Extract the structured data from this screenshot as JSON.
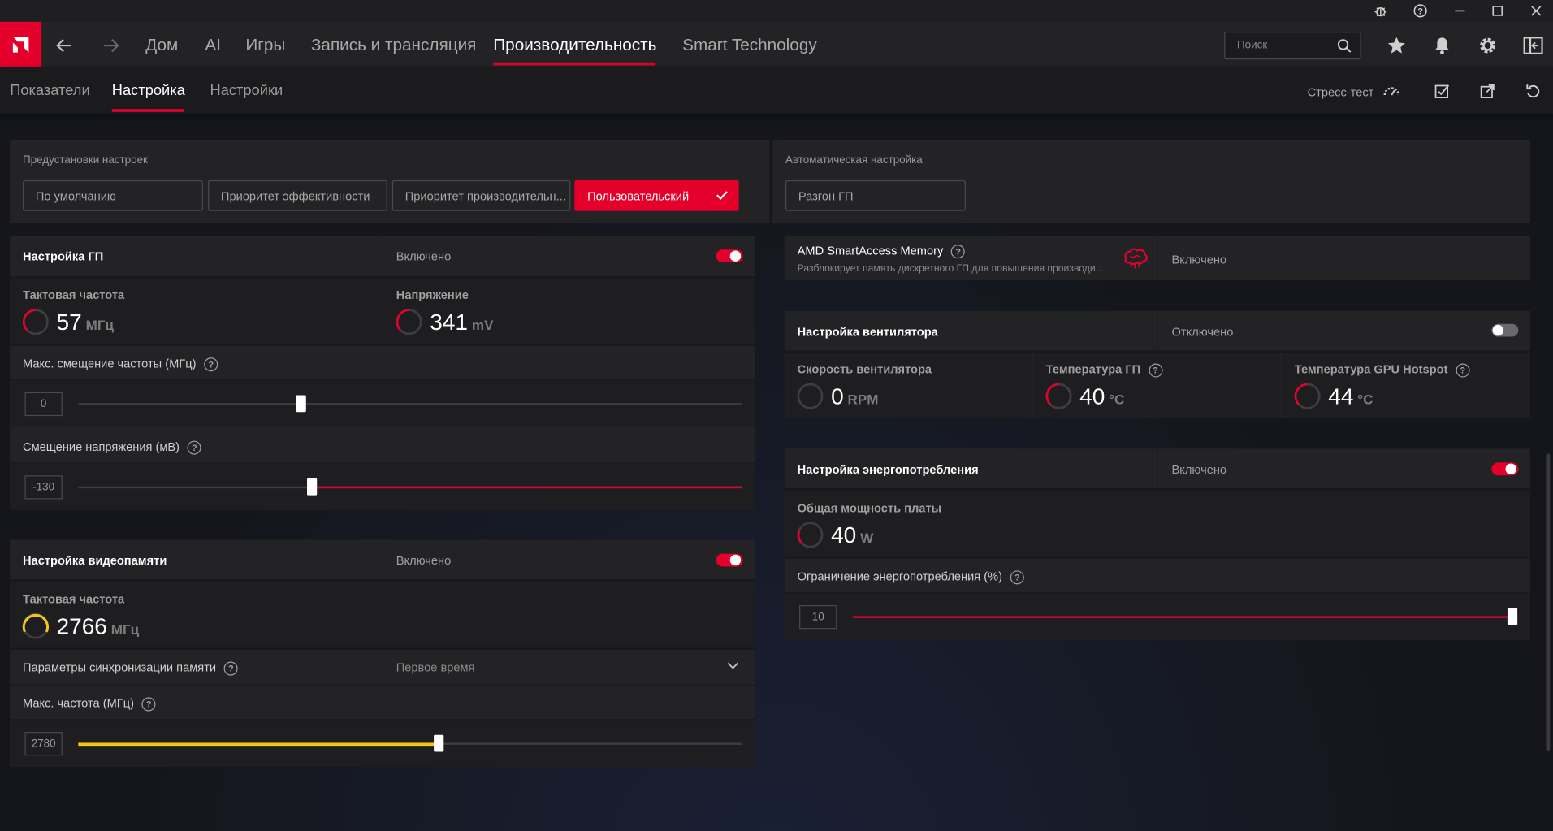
{
  "nav": {
    "items": [
      "Дом",
      "AI",
      "Игры",
      "Запись и трансляция",
      "Производительность",
      "Smart Technology"
    ],
    "active": "Производительность",
    "search_placeholder": "Поиск"
  },
  "subnav": {
    "tabs": [
      "Показатели",
      "Настройка",
      "Настройки"
    ],
    "active": "Настройка",
    "stress_test": "Стресс-тест"
  },
  "presets": {
    "label": "Предустановки настроек",
    "buttons": [
      "По умолчанию",
      "Приоритет эффективности",
      "Приоритет производительн...",
      "Пользовательский"
    ],
    "selected": "Пользовательский"
  },
  "auto_tune": {
    "label": "Автоматическая настройка",
    "button": "Разгон ГП"
  },
  "gpu_tuning": {
    "title": "Настройка ГП",
    "state": "Включено",
    "clock": {
      "label": "Тактовая частота",
      "value": "57",
      "unit": "МГц"
    },
    "voltage": {
      "label": "Напряжение",
      "value": "341",
      "unit": "mV"
    },
    "max_offset": {
      "label": "Макс. смещение частоты (МГц)",
      "value": "0",
      "percent": 33.5
    },
    "voltage_offset": {
      "label": "Смещение напряжения (мВ)",
      "value": "-130",
      "percent": 35
    }
  },
  "vram_tuning": {
    "title": "Настройка видеопамяти",
    "state": "Включено",
    "clock": {
      "label": "Тактовая частота",
      "value": "2766",
      "unit": "МГц"
    },
    "timing": {
      "label": "Параметры синхронизации памяти",
      "value": "Первое время"
    },
    "max_clock": {
      "label": "Макс. частота (МГц)",
      "value": "2780",
      "percent": 54
    }
  },
  "sam": {
    "title": "AMD SmartAccess Memory",
    "desc": "Разблокирует память дискретного ГП для повышения производи...",
    "state": "Включено"
  },
  "fan_tuning": {
    "title": "Настройка вентилятора",
    "state": "Отключено",
    "speed": {
      "label": "Скорость вентилятора",
      "value": "0",
      "unit": "RPM"
    },
    "gpu_temp": {
      "label": "Температура ГП",
      "value": "40",
      "unit": "°C"
    },
    "hotspot": {
      "label": "Температура GPU Hotspot",
      "value": "44",
      "unit": "°C"
    }
  },
  "power_tuning": {
    "title": "Настройка энергопотребления",
    "state": "Включено",
    "board_power": {
      "label": "Общая мощность платы",
      "value": "40",
      "unit": "W"
    },
    "limit": {
      "label": "Ограничение энергопотребления (%)",
      "value": "10",
      "percent": 100
    }
  },
  "colors": {
    "accent": "#e4002b",
    "yellow": "#f5c518",
    "panel": "#232326"
  }
}
